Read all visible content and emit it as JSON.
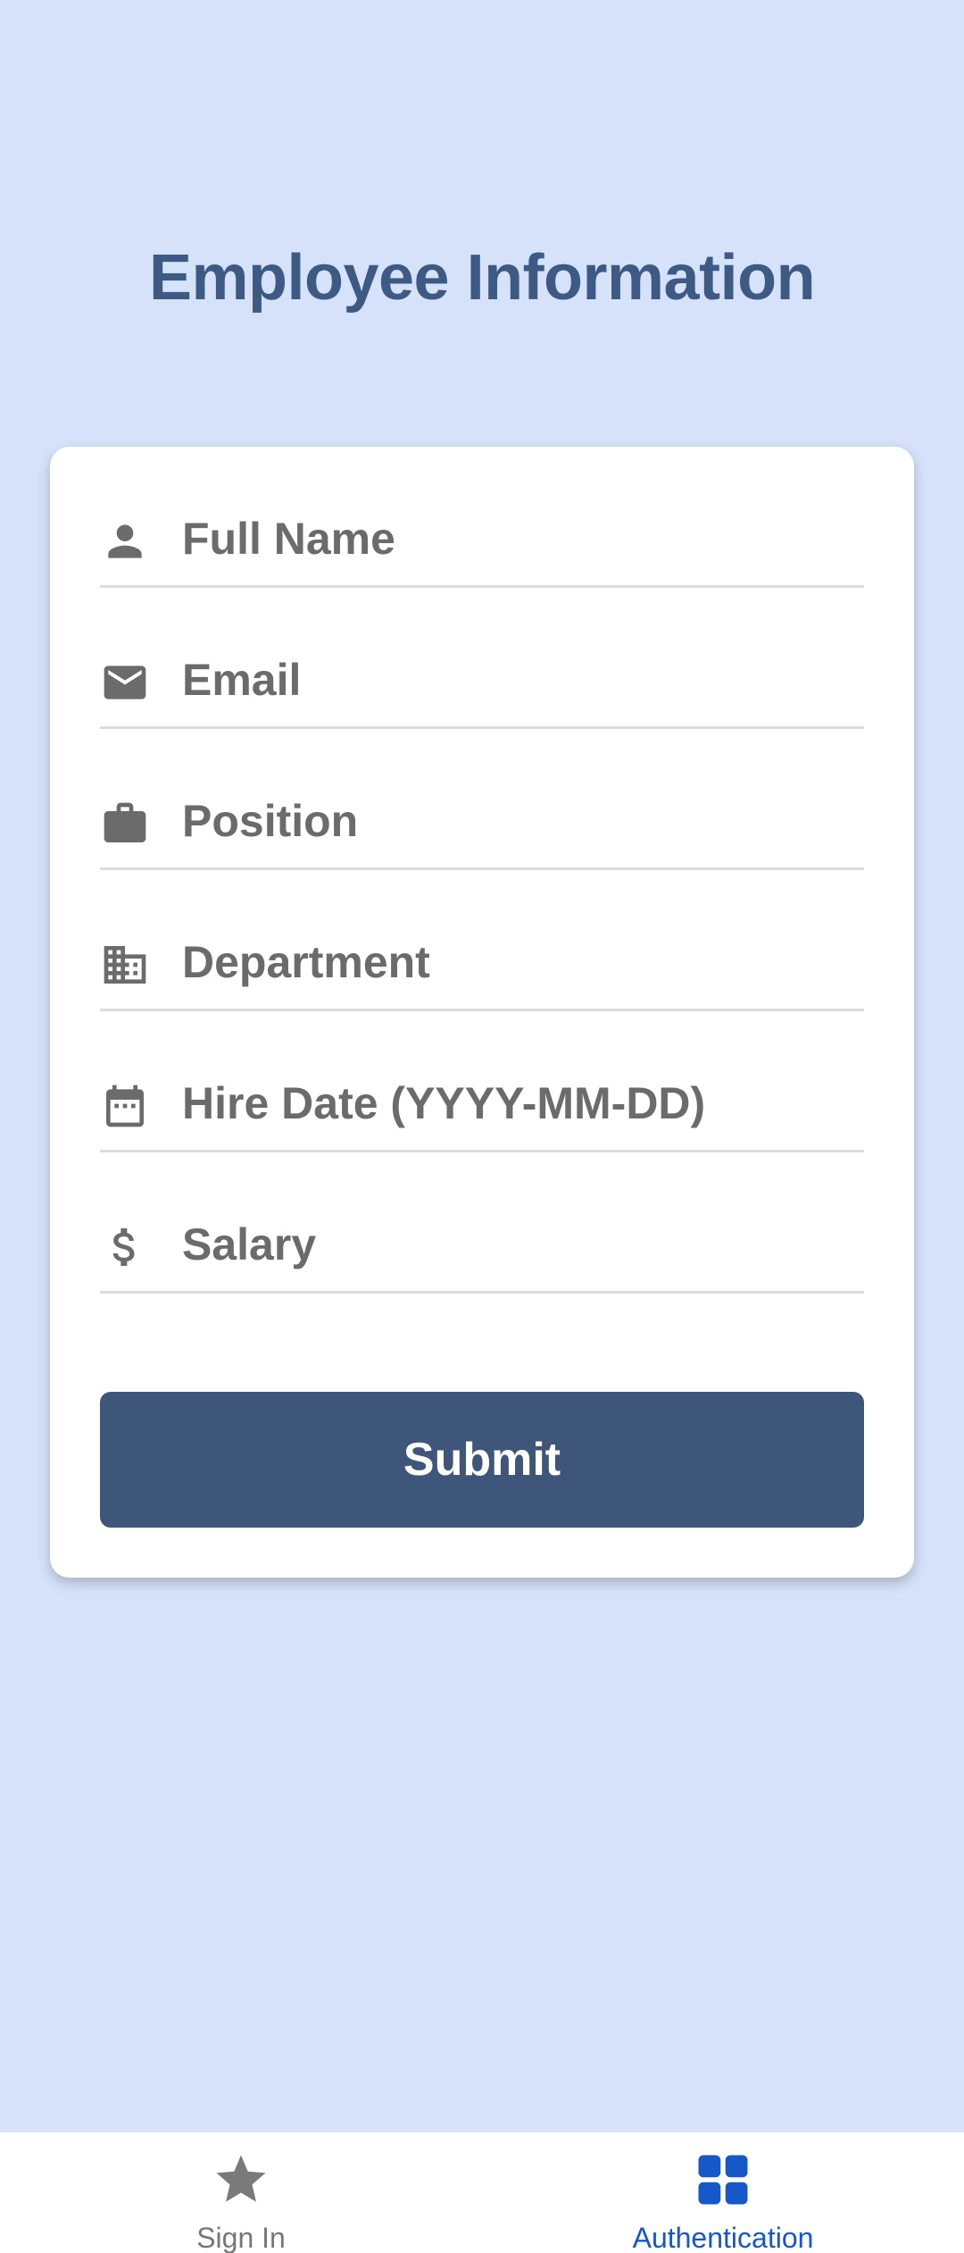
{
  "header": {
    "title": "Employee Information"
  },
  "form": {
    "fields": [
      {
        "icon": "person-icon",
        "placeholder": "Full Name",
        "value": ""
      },
      {
        "icon": "mail-icon",
        "placeholder": "Email",
        "value": ""
      },
      {
        "icon": "briefcase-icon",
        "placeholder": "Position",
        "value": ""
      },
      {
        "icon": "building-icon",
        "placeholder": "Department",
        "value": ""
      },
      {
        "icon": "calendar-icon",
        "placeholder": "Hire Date (YYYY-MM-DD)",
        "value": ""
      },
      {
        "icon": "dollar-icon",
        "placeholder": "Salary",
        "value": ""
      }
    ],
    "submit_label": "Submit"
  },
  "bottom_nav": {
    "items": [
      {
        "label": "Sign In",
        "icon": "star-icon",
        "active": false
      },
      {
        "label": "Authentication",
        "icon": "grid-icon",
        "active": true
      }
    ]
  },
  "colors": {
    "background": "#d6e2fa",
    "title": "#3d5a85",
    "button": "#3d5679",
    "active_nav": "#1657c9",
    "inactive_nav": "#777777"
  }
}
